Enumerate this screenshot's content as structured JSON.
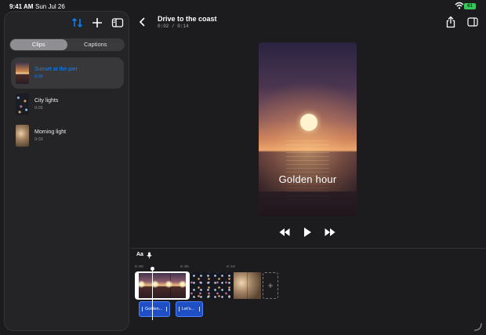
{
  "status_bar": {
    "time": "9:41 AM",
    "date": "Sun Jul 26",
    "battery": "61"
  },
  "sidebar": {
    "segments": [
      "Clips",
      "Captions"
    ],
    "active_segment": "Clips",
    "clips": [
      {
        "name": "Sunset at the pier",
        "duration": "0:06",
        "selected": true
      },
      {
        "name": "City lights",
        "duration": "0:05",
        "selected": false
      },
      {
        "name": "Morning light",
        "duration": "0:03",
        "selected": false
      }
    ]
  },
  "header": {
    "title": "Drive to the coast",
    "time": "0:02 / 0:14"
  },
  "preview": {
    "caption": "Golden hour"
  },
  "timeline": {
    "font_button": "Aa",
    "ruler": [
      "0:00",
      "0:05",
      "0:10"
    ],
    "add_clip": "+",
    "captions": [
      "Golden...",
      "Let's..."
    ]
  },
  "colors": {
    "accent": "#0a84ff",
    "caption_chip": "#1f4fc4",
    "battery": "#34c759"
  }
}
